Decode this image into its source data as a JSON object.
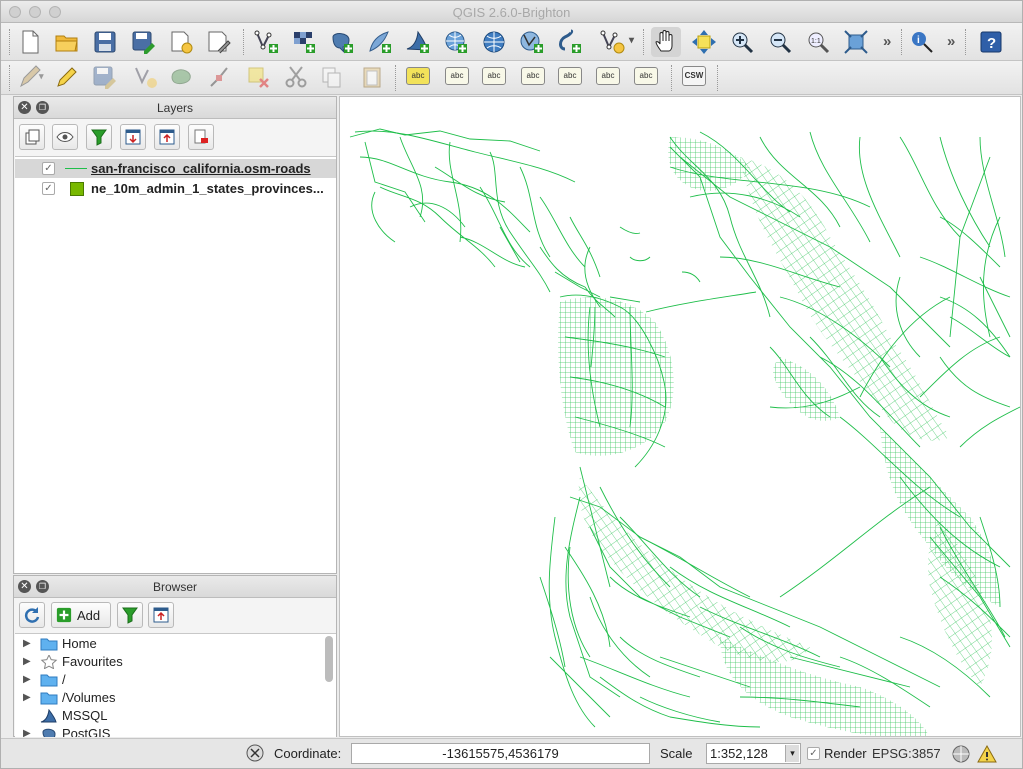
{
  "window": {
    "title": "QGIS 2.6.0-Brighton"
  },
  "toolbar_main": {
    "icons": [
      "new-project-icon",
      "open-project-icon",
      "save-project-icon",
      "save-as-icon",
      "new-print-composer-icon",
      "composer-manager-icon",
      "add-vector-layer-icon",
      "add-raster-layer-icon",
      "add-postgis-layer-icon",
      "add-spatialite-layer-icon",
      "add-mssql-layer-icon",
      "add-wms-layer-icon",
      "add-wcs-layer-icon",
      "add-wfs-layer-icon",
      "add-delimited-text-icon",
      "new-shapefile-icon",
      "pan-icon",
      "pan-to-selection-icon",
      "zoom-in-icon",
      "zoom-out-icon",
      "zoom-actual-icon",
      "zoom-full-icon",
      "identify-icon",
      "help-icon"
    ],
    "overflow": "»"
  },
  "toolbar_digitize": {
    "icons": [
      "current-edits-icon",
      "toggle-editing-icon",
      "save-edits-icon",
      "add-feature-icon",
      "move-feature-icon",
      "node-tool-icon",
      "delete-selected-icon",
      "cut-features-icon",
      "copy-features-icon",
      "paste-features-icon"
    ],
    "label_tools": [
      "abc",
      "abc",
      "abc",
      "abc",
      "abc",
      "abc",
      "abc"
    ],
    "csw_label": "CSW"
  },
  "layers_panel": {
    "title": "Layers",
    "layers": [
      {
        "name": "san-francisco_california.osm-roads",
        "checked": true,
        "symbol": "line",
        "color": "#1fbe4a",
        "selected": true
      },
      {
        "name": "ne_10m_admin_1_states_provinces...",
        "checked": true,
        "symbol": "fill",
        "color": "#78b800",
        "selected": false
      }
    ]
  },
  "browser_panel": {
    "title": "Browser",
    "add_label": "Add",
    "items": [
      {
        "label": "Home",
        "icon": "folder-icon"
      },
      {
        "label": "Favourites",
        "icon": "star-icon"
      },
      {
        "label": "/",
        "icon": "folder-icon"
      },
      {
        "label": "/Volumes",
        "icon": "folder-icon"
      },
      {
        "label": "MSSQL",
        "icon": "mssql-icon"
      },
      {
        "label": "PostGIS",
        "icon": "postgis-icon"
      }
    ]
  },
  "statusbar": {
    "coordinate_label": "Coordinate:",
    "coordinate_value": "-13615575,4536179",
    "scale_label": "Scale",
    "scale_value": "1:352,128",
    "render_label": "Render",
    "render_checked": true,
    "crs": "EPSG:3857"
  },
  "colors": {
    "road": "#1fbe4a",
    "selection": "#d7d7d7"
  }
}
